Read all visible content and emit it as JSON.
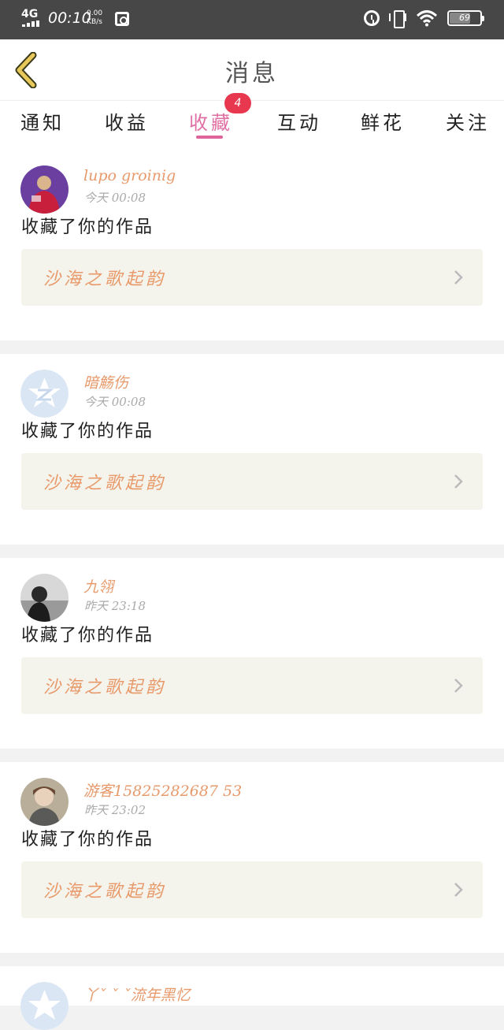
{
  "status_bar": {
    "network": "4G",
    "time": "00:10",
    "speed_value": "0.00",
    "speed_unit": "KB/s",
    "battery": "69",
    "battery_level": 0.69
  },
  "header": {
    "title": "消息"
  },
  "tabs": [
    {
      "label": "通知"
    },
    {
      "label": "收益"
    },
    {
      "label": "收藏",
      "active": true,
      "badge": "4"
    },
    {
      "label": "互动"
    },
    {
      "label": "鲜花"
    },
    {
      "label": "关注"
    }
  ],
  "messages": [
    {
      "username": "lupo groinig",
      "time": "今天 00:08",
      "action": "收藏了你的作品",
      "work_title": "沙海之歌起韵",
      "avatar": "photo-red"
    },
    {
      "username": "暗觞伤",
      "time": "今天 00:08",
      "action": "收藏了你的作品",
      "work_title": "沙海之歌起韵",
      "avatar": "default"
    },
    {
      "username": "九翎",
      "time": "昨天 23:18",
      "action": "收藏了你的作品",
      "work_title": "沙海之歌起韵",
      "avatar": "photo-bw"
    },
    {
      "username": "游客15825282687 53",
      "time": "昨天 23:02",
      "action": "收藏了你的作品",
      "work_title": "沙海之歌起韵",
      "avatar": "photo-boy"
    },
    {
      "username": "丫ˇ ˇ ˇ流年黑忆",
      "time": "",
      "action": "",
      "work_title": "",
      "avatar": "default"
    }
  ],
  "colors": {
    "accent_pink": "#e06fa4",
    "badge_red": "#e8384f",
    "username_orange": "#e79a6c",
    "work_bg": "#f4f3ec",
    "back_arrow": "#e8c85a"
  }
}
